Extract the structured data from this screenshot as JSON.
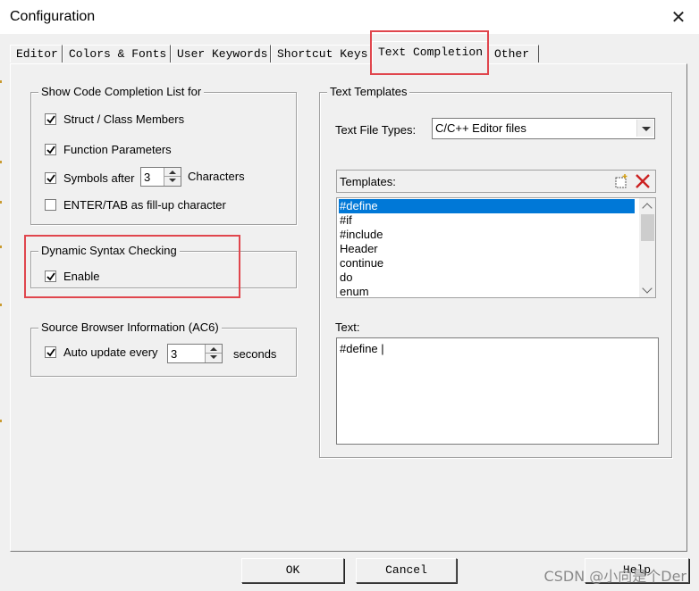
{
  "window": {
    "title": "Configuration",
    "close_glyph": "✕"
  },
  "tabs": [
    {
      "label": "Editor"
    },
    {
      "label": "Colors & Fonts"
    },
    {
      "label": "User Keywords"
    },
    {
      "label": "Shortcut Keys"
    },
    {
      "label": "Text Completion",
      "active": true
    },
    {
      "label": "Other"
    }
  ],
  "completion_group": {
    "title": "Show Code Completion List for",
    "struct_members": {
      "label": "Struct / Class Members",
      "checked": true
    },
    "function_params": {
      "label": "Function Parameters",
      "checked": true
    },
    "symbols_after": {
      "label": "Symbols after",
      "value": "3",
      "suffix": "Characters",
      "checked": true
    },
    "enter_tab": {
      "label": "ENTER/TAB as fill-up character",
      "checked": false
    }
  },
  "syntax_group": {
    "title": "Dynamic Syntax Checking",
    "enable": {
      "label": "Enable",
      "checked": true
    }
  },
  "browser_group": {
    "title": "Source Browser Information (AC6)",
    "auto_update": {
      "label": "Auto update every",
      "value": "3",
      "suffix": "seconds",
      "checked": true
    }
  },
  "templates_group": {
    "title": "Text Templates",
    "file_types_label": "Text File Types:",
    "file_types_value": "C/C++ Editor files",
    "templates_label": "Templates:",
    "templates": [
      "#define",
      "#if",
      "#include",
      "Header",
      "continue",
      "do",
      "enum"
    ],
    "selected_index": 0,
    "text_label": "Text:",
    "text_value": "#define |"
  },
  "buttons": {
    "ok": "OK",
    "cancel": "Cancel",
    "help": "Help"
  },
  "watermark": "CSDN @小向是个Der",
  "colors": {
    "highlight": "#e0464d",
    "selection": "#0078d7",
    "delete_icon": "#cc2222"
  }
}
